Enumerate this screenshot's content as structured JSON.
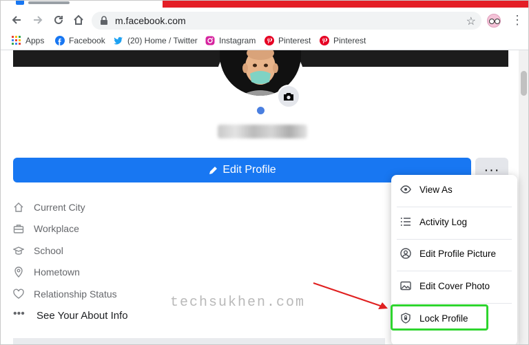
{
  "browser": {
    "url": "m.facebook.com",
    "bookmarks": [
      {
        "label": "Apps",
        "icon": "apps-grid-icon"
      },
      {
        "label": "Facebook",
        "icon": "facebook-icon"
      },
      {
        "label": "(20) Home / Twitter",
        "icon": "twitter-icon"
      },
      {
        "label": "Instagram",
        "icon": "instagram-icon"
      },
      {
        "label": "Pinterest",
        "icon": "pinterest-icon"
      },
      {
        "label": "Pinterest",
        "icon": "pinterest-icon"
      }
    ]
  },
  "profile": {
    "edit_profile_label": "Edit Profile",
    "more_label": "···",
    "info": [
      {
        "label": "Current City",
        "icon": "home-icon"
      },
      {
        "label": "Workplace",
        "icon": "briefcase-icon"
      },
      {
        "label": "School",
        "icon": "graduation-cap-icon"
      },
      {
        "label": "Hometown",
        "icon": "location-pin-icon"
      },
      {
        "label": "Relationship Status",
        "icon": "heart-icon"
      }
    ],
    "see_about": "See Your About Info"
  },
  "menu": {
    "items": [
      {
        "label": "View As",
        "icon": "eye-icon"
      },
      {
        "label": "Activity Log",
        "icon": "list-icon"
      },
      {
        "label": "Edit Profile Picture",
        "icon": "user-circle-icon"
      },
      {
        "label": "Edit Cover Photo",
        "icon": "image-icon"
      },
      {
        "label": "Lock Profile",
        "icon": "shield-icon"
      }
    ]
  },
  "watermark": "techsukhen.com",
  "colors": {
    "fb_blue": "#1877f2",
    "highlight_green": "#2ed52e",
    "arrow_red": "#e02020"
  }
}
